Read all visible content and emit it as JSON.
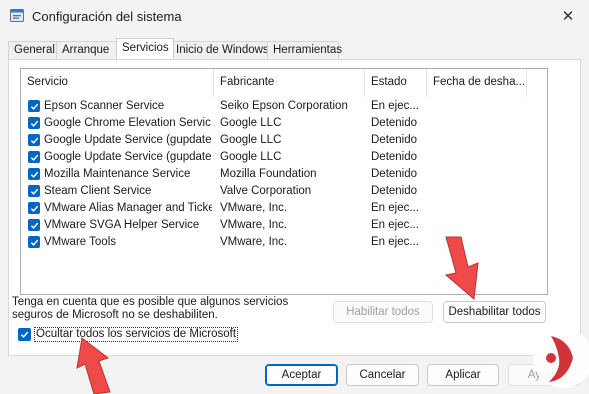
{
  "window": {
    "title": "Configuración del sistema",
    "close_glyph": "✕"
  },
  "tabs": [
    {
      "label": "General"
    },
    {
      "label": "Arranque"
    },
    {
      "label": "Servicios"
    },
    {
      "label": "Inicio de Windows"
    },
    {
      "label": "Herramientas"
    }
  ],
  "list": {
    "columns": [
      "Servicio",
      "Fabricante",
      "Estado",
      "Fecha de desha..."
    ],
    "rows": [
      {
        "service": "Epson Scanner Service",
        "vendor": "Seiko Epson Corporation",
        "status": "En ejec...",
        "checked": true
      },
      {
        "service": "Google Chrome Elevation Servic...",
        "vendor": "Google LLC",
        "status": "Detenido",
        "checked": true
      },
      {
        "service": "Google Update Service (gupdate)",
        "vendor": "Google LLC",
        "status": "Detenido",
        "checked": true
      },
      {
        "service": "Google Update Service (gupdatem)",
        "vendor": "Google LLC",
        "status": "Detenido",
        "checked": true
      },
      {
        "service": "Mozilla Maintenance Service",
        "vendor": "Mozilla Foundation",
        "status": "Detenido",
        "checked": true
      },
      {
        "service": "Steam Client Service",
        "vendor": "Valve Corporation",
        "status": "Detenido",
        "checked": true
      },
      {
        "service": "VMware Alias Manager and Ticke...",
        "vendor": "VMware, Inc.",
        "status": "En ejec...",
        "checked": true
      },
      {
        "service": "VMware SVGA Helper Service",
        "vendor": "VMware, Inc.",
        "status": "En ejec...",
        "checked": true
      },
      {
        "service": "VMware Tools",
        "vendor": "VMware, Inc.",
        "status": "En ejec...",
        "checked": true
      }
    ]
  },
  "note": {
    "line1": "Tenga en cuenta que es posible que algunos servicios",
    "line2": "seguros de Microsoft no se deshabiliten."
  },
  "buttons": {
    "enable_all": "Habilitar todos",
    "disable_all": "Deshabilitar todos",
    "ok": "Aceptar",
    "cancel": "Cancelar",
    "apply": "Aplicar",
    "help": "Ayuda"
  },
  "hide_microsoft": {
    "label": "Ocultar todos los servicios de Microsoft",
    "checked": true
  },
  "colors": {
    "accent": "#0067c0",
    "arrow": "#ef4a4a",
    "logo": "#d13438"
  }
}
